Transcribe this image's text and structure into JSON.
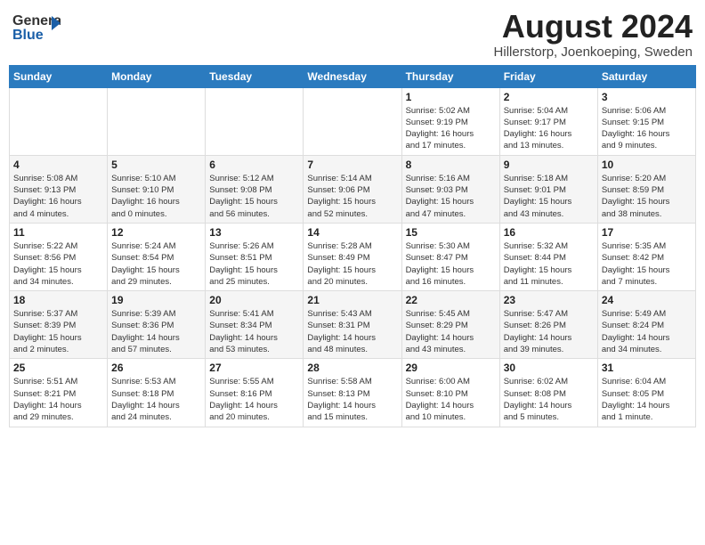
{
  "header": {
    "logo_general": "General",
    "logo_blue": "Blue",
    "month_title": "August 2024",
    "subtitle": "Hillerstorp, Joenkoeping, Sweden"
  },
  "days_of_week": [
    "Sunday",
    "Monday",
    "Tuesday",
    "Wednesday",
    "Thursday",
    "Friday",
    "Saturday"
  ],
  "weeks": [
    [
      {
        "day": "",
        "info": ""
      },
      {
        "day": "",
        "info": ""
      },
      {
        "day": "",
        "info": ""
      },
      {
        "day": "",
        "info": ""
      },
      {
        "day": "1",
        "info": "Sunrise: 5:02 AM\nSunset: 9:19 PM\nDaylight: 16 hours\nand 17 minutes."
      },
      {
        "day": "2",
        "info": "Sunrise: 5:04 AM\nSunset: 9:17 PM\nDaylight: 16 hours\nand 13 minutes."
      },
      {
        "day": "3",
        "info": "Sunrise: 5:06 AM\nSunset: 9:15 PM\nDaylight: 16 hours\nand 9 minutes."
      }
    ],
    [
      {
        "day": "4",
        "info": "Sunrise: 5:08 AM\nSunset: 9:13 PM\nDaylight: 16 hours\nand 4 minutes."
      },
      {
        "day": "5",
        "info": "Sunrise: 5:10 AM\nSunset: 9:10 PM\nDaylight: 16 hours\nand 0 minutes."
      },
      {
        "day": "6",
        "info": "Sunrise: 5:12 AM\nSunset: 9:08 PM\nDaylight: 15 hours\nand 56 minutes."
      },
      {
        "day": "7",
        "info": "Sunrise: 5:14 AM\nSunset: 9:06 PM\nDaylight: 15 hours\nand 52 minutes."
      },
      {
        "day": "8",
        "info": "Sunrise: 5:16 AM\nSunset: 9:03 PM\nDaylight: 15 hours\nand 47 minutes."
      },
      {
        "day": "9",
        "info": "Sunrise: 5:18 AM\nSunset: 9:01 PM\nDaylight: 15 hours\nand 43 minutes."
      },
      {
        "day": "10",
        "info": "Sunrise: 5:20 AM\nSunset: 8:59 PM\nDaylight: 15 hours\nand 38 minutes."
      }
    ],
    [
      {
        "day": "11",
        "info": "Sunrise: 5:22 AM\nSunset: 8:56 PM\nDaylight: 15 hours\nand 34 minutes."
      },
      {
        "day": "12",
        "info": "Sunrise: 5:24 AM\nSunset: 8:54 PM\nDaylight: 15 hours\nand 29 minutes."
      },
      {
        "day": "13",
        "info": "Sunrise: 5:26 AM\nSunset: 8:51 PM\nDaylight: 15 hours\nand 25 minutes."
      },
      {
        "day": "14",
        "info": "Sunrise: 5:28 AM\nSunset: 8:49 PM\nDaylight: 15 hours\nand 20 minutes."
      },
      {
        "day": "15",
        "info": "Sunrise: 5:30 AM\nSunset: 8:47 PM\nDaylight: 15 hours\nand 16 minutes."
      },
      {
        "day": "16",
        "info": "Sunrise: 5:32 AM\nSunset: 8:44 PM\nDaylight: 15 hours\nand 11 minutes."
      },
      {
        "day": "17",
        "info": "Sunrise: 5:35 AM\nSunset: 8:42 PM\nDaylight: 15 hours\nand 7 minutes."
      }
    ],
    [
      {
        "day": "18",
        "info": "Sunrise: 5:37 AM\nSunset: 8:39 PM\nDaylight: 15 hours\nand 2 minutes."
      },
      {
        "day": "19",
        "info": "Sunrise: 5:39 AM\nSunset: 8:36 PM\nDaylight: 14 hours\nand 57 minutes."
      },
      {
        "day": "20",
        "info": "Sunrise: 5:41 AM\nSunset: 8:34 PM\nDaylight: 14 hours\nand 53 minutes."
      },
      {
        "day": "21",
        "info": "Sunrise: 5:43 AM\nSunset: 8:31 PM\nDaylight: 14 hours\nand 48 minutes."
      },
      {
        "day": "22",
        "info": "Sunrise: 5:45 AM\nSunset: 8:29 PM\nDaylight: 14 hours\nand 43 minutes."
      },
      {
        "day": "23",
        "info": "Sunrise: 5:47 AM\nSunset: 8:26 PM\nDaylight: 14 hours\nand 39 minutes."
      },
      {
        "day": "24",
        "info": "Sunrise: 5:49 AM\nSunset: 8:24 PM\nDaylight: 14 hours\nand 34 minutes."
      }
    ],
    [
      {
        "day": "25",
        "info": "Sunrise: 5:51 AM\nSunset: 8:21 PM\nDaylight: 14 hours\nand 29 minutes."
      },
      {
        "day": "26",
        "info": "Sunrise: 5:53 AM\nSunset: 8:18 PM\nDaylight: 14 hours\nand 24 minutes."
      },
      {
        "day": "27",
        "info": "Sunrise: 5:55 AM\nSunset: 8:16 PM\nDaylight: 14 hours\nand 20 minutes."
      },
      {
        "day": "28",
        "info": "Sunrise: 5:58 AM\nSunset: 8:13 PM\nDaylight: 14 hours\nand 15 minutes."
      },
      {
        "day": "29",
        "info": "Sunrise: 6:00 AM\nSunset: 8:10 PM\nDaylight: 14 hours\nand 10 minutes."
      },
      {
        "day": "30",
        "info": "Sunrise: 6:02 AM\nSunset: 8:08 PM\nDaylight: 14 hours\nand 5 minutes."
      },
      {
        "day": "31",
        "info": "Sunrise: 6:04 AM\nSunset: 8:05 PM\nDaylight: 14 hours\nand 1 minute."
      }
    ]
  ]
}
